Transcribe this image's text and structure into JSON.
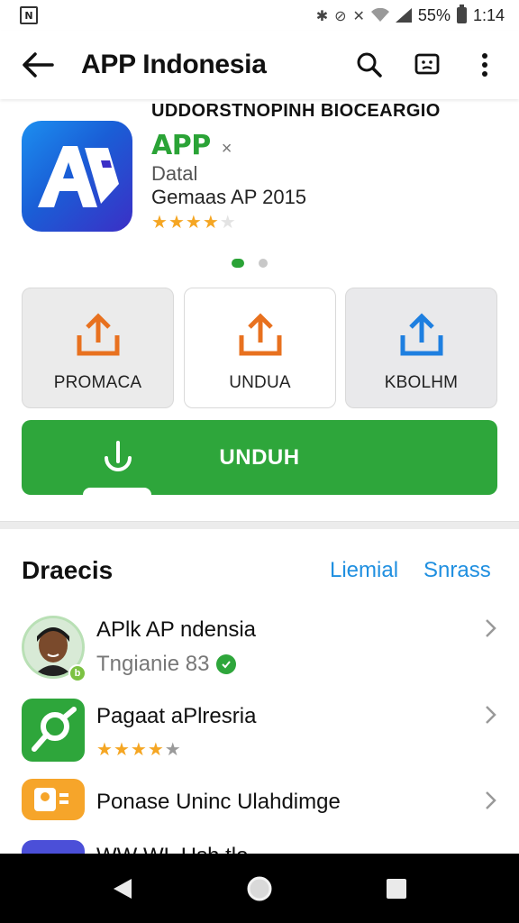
{
  "status_bar": {
    "battery": "55%",
    "time": "1:14"
  },
  "app_bar": {
    "title": "APP Indonesia"
  },
  "header": {
    "heading": "UDDORSTNOPINH BIOCEARGIO"
  },
  "app": {
    "name": "APP",
    "name_suffix": "×",
    "subtitle": "Datal",
    "meta": "Gemaas AP 2015",
    "rating_filled": 4,
    "rating_total": 5
  },
  "carousel": {
    "pages": 2,
    "active": 1
  },
  "actions": [
    {
      "label": "PROMACA",
      "icon": "upload-icon",
      "color": "#e8711f"
    },
    {
      "label": "UNDUA",
      "icon": "upload-icon",
      "color": "#e8711f"
    },
    {
      "label": "KBOLHM",
      "icon": "upload-icon",
      "color": "#1e7fe0"
    }
  ],
  "download_button": {
    "label": "UNDUH"
  },
  "list": {
    "title": "Draecis",
    "link_1": "Liemial",
    "link_2": "Snrass",
    "items": [
      {
        "title": "APlk AP ndensia",
        "subtitle": "Tngianie 83",
        "avatar_badge": "b"
      },
      {
        "title": "Pagaat aPlresria",
        "rating_filled": 4,
        "rating_total": 5
      },
      {
        "title": "Ponase Uninc Ulahdimge"
      },
      {
        "title": "WW WL Hsh tlo"
      }
    ]
  },
  "colors": {
    "brand_green": "#2ea63b",
    "link_blue": "#1f8fe0",
    "star_orange": "#f5a623"
  }
}
